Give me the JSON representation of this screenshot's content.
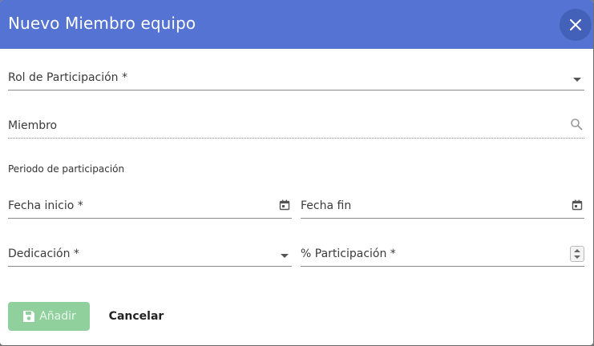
{
  "dialog": {
    "title": "Nuevo Miembro equipo"
  },
  "fields": {
    "rol": {
      "label": "Rol de Participación *"
    },
    "miembro": {
      "label": "Miembro"
    },
    "periodo_label": "Periodo de participación",
    "fecha_inicio": {
      "label": "Fecha inicio *"
    },
    "fecha_fin": {
      "label": "Fecha fin"
    },
    "dedicacion": {
      "label": "Dedicación *"
    },
    "participacion": {
      "label": "% Participación *"
    }
  },
  "actions": {
    "add_label": "Añadir",
    "cancel_label": "Cancelar"
  },
  "colors": {
    "header": "#5473d3",
    "add_button": "#8fd09d"
  },
  "icons": {
    "close": "close-icon",
    "search": "search-icon",
    "calendar": "calendar-icon",
    "save": "save-icon"
  }
}
